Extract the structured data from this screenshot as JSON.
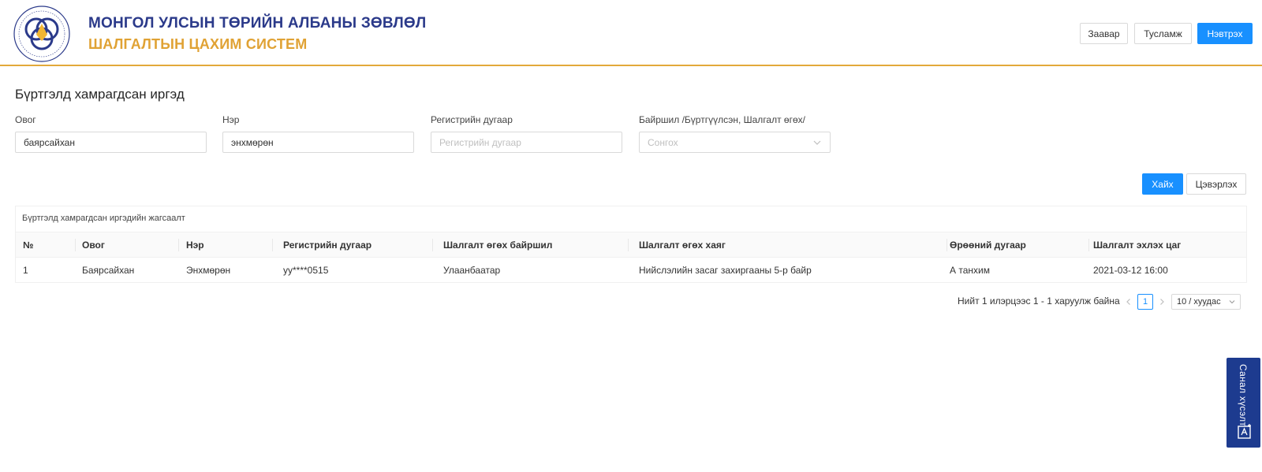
{
  "header": {
    "title": "МОНГОЛ УЛСЫН ТӨРИЙН АЛБАНЫ ЗӨВЛӨЛ",
    "subtitle": "ШАЛГАЛТЫН ЦАХИМ СИСТЕМ",
    "buttons": {
      "guide": "Заавар",
      "help": "Тусламж",
      "login": "Нэвтрэх"
    }
  },
  "page": {
    "title": "Бүртгэлд хамрагдсан иргэд"
  },
  "filters": {
    "surname": {
      "label": "Овог",
      "value": "баярсайхан"
    },
    "name": {
      "label": "Нэр",
      "value": "энхмөрөн"
    },
    "register": {
      "label": "Регистрийн дугаар",
      "placeholder": "Регистрийн дугаар"
    },
    "location": {
      "label": "Байршил /Бүртгүүлсэн, Шалгалт өгөх/",
      "placeholder": "Сонгох"
    }
  },
  "actions": {
    "search": "Хайх",
    "clear": "Цэвэрлэх"
  },
  "table": {
    "title": "Бүртгэлд хамрагдсан иргэдийн жагсаалт",
    "columns": [
      "№",
      "Овог",
      "Нэр",
      "Регистрийн дугаар",
      "Шалгалт өгөх байршил",
      "Шалгалт өгөх хаяг",
      "Өрөөний дугаар",
      "Шалгалт эхлэх цаг"
    ],
    "rows": [
      [
        "1",
        "Баярсайхан",
        "Энхмөрөн",
        "уу****0515",
        "Улаанбаатар",
        "Нийслэлийн засаг захиргааны 5-р байр",
        "А танхим",
        "2021-03-12 16:00"
      ]
    ]
  },
  "pagination": {
    "summary": "Нийт 1 илэрцээс 1 - 1 харуулж байна",
    "current_page": "1",
    "page_size": "10 / хуудас"
  },
  "feedback": {
    "label": "Санал хүсэлт"
  },
  "colors": {
    "primary": "#1890ff",
    "brand_blue": "#2b3a8a",
    "brand_gold": "#e0a234",
    "feedback_bg": "#1d3b8f"
  },
  "icons": [
    "logo-seal",
    "chevron-down-icon",
    "chevron-left-icon",
    "chevron-right-icon",
    "feedback-icon"
  ]
}
